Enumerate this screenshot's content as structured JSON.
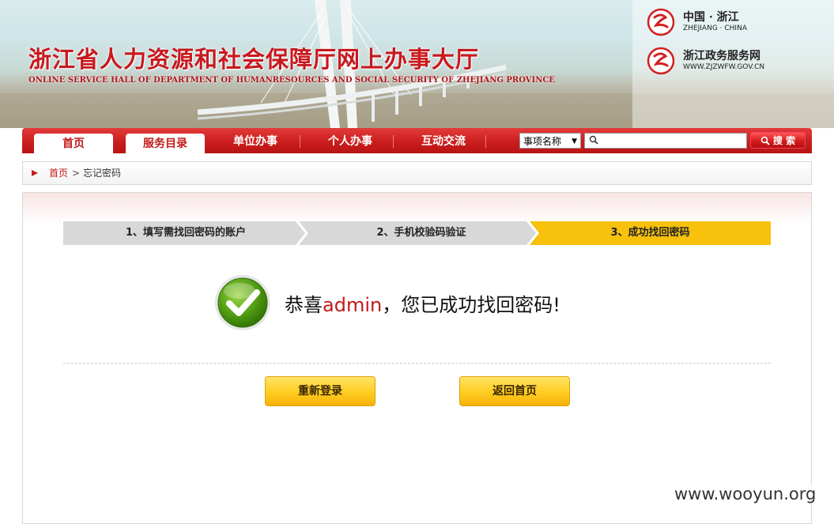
{
  "header": {
    "title": "浙江省人力资源和社会保障厅网上办事大厅",
    "subtitle": "ONLINE SERVICE HALL OF DEPARTMENT OF HUMANRESOURCES AND SOCIAL SECURITY OF ZHEJIANG PROVINCE",
    "logo_china": {
      "line1": "中国 · 浙江",
      "line2": "ZHEJIANG · CHINA"
    },
    "logo_gov": {
      "line1": "浙江政务服务网",
      "line2": "WWW.ZJZWFW.GOV.CN"
    }
  },
  "nav": {
    "items": [
      {
        "label": "首页"
      },
      {
        "label": "服务目录"
      },
      {
        "label": "单位办事"
      },
      {
        "label": "个人办事"
      },
      {
        "label": "互动交流"
      }
    ],
    "search": {
      "select_value": "事项名称",
      "input_value": "",
      "button_label": "搜 索"
    }
  },
  "breadcrumb": {
    "home": "首页",
    "separator": ">",
    "current": "忘记密码"
  },
  "steps": [
    {
      "label": "1、填写需找回密码的账户",
      "active": false
    },
    {
      "label": "2、手机校验码验证",
      "active": false
    },
    {
      "label": "3、成功找回密码",
      "active": true
    }
  ],
  "result": {
    "prefix": "恭喜",
    "username": "admin",
    "suffix": "，您已成功找回密码!"
  },
  "buttons": {
    "relogin": "重新登录",
    "home": "返回首页"
  },
  "watermark": "www.wooyun.org",
  "colors": {
    "brand_red": "#c21a1a",
    "active_step": "#f7c10c",
    "button_yellow": "#ffcc20"
  }
}
